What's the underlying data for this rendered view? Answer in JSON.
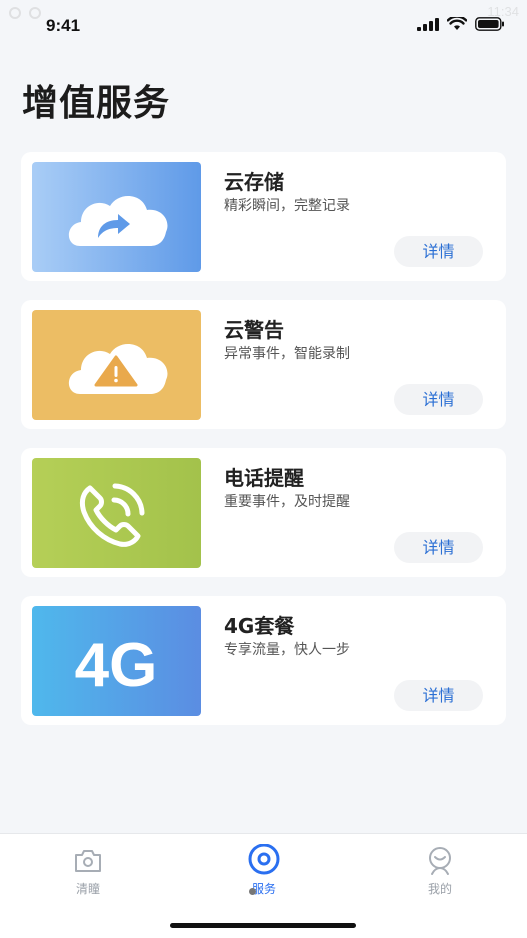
{
  "status_bar": {
    "time": "9:41",
    "ghost_text": "11:34"
  },
  "page": {
    "title": "增值服务"
  },
  "services": [
    {
      "name": "云存储",
      "desc": "精彩瞬间，完整记录",
      "button": "详情",
      "icon": "cloud-share-icon",
      "gradient": [
        "#a9cdf6",
        "#5f9ae8"
      ]
    },
    {
      "name": "云警告",
      "desc": "异常事件，智能录制",
      "button": "详情",
      "icon": "cloud-warning-icon",
      "gradient": [
        "#f0c46e",
        "#e9b75e"
      ]
    },
    {
      "name": "电话提醒",
      "desc": "重要事件，及时提醒",
      "button": "详情",
      "icon": "phone-ringing-icon",
      "gradient": [
        "#b5cf57",
        "#a3c24b"
      ]
    },
    {
      "name": "4G套餐",
      "desc": "专享流量，快人一步",
      "button": "详情",
      "icon": "text-4g",
      "icon_text": "4G",
      "gradient": [
        "#4fb8ec",
        "#5b8de2"
      ]
    }
  ],
  "tab_bar": {
    "tabs": [
      {
        "label": "清瞳",
        "icon": "camera-icon",
        "active": false
      },
      {
        "label": "服务",
        "icon": "eye-target-icon",
        "active": true
      },
      {
        "label": "我的",
        "icon": "user-icon",
        "active": false
      }
    ],
    "active_color": "#2a6ff0",
    "inactive_color": "#9aa0a8"
  }
}
